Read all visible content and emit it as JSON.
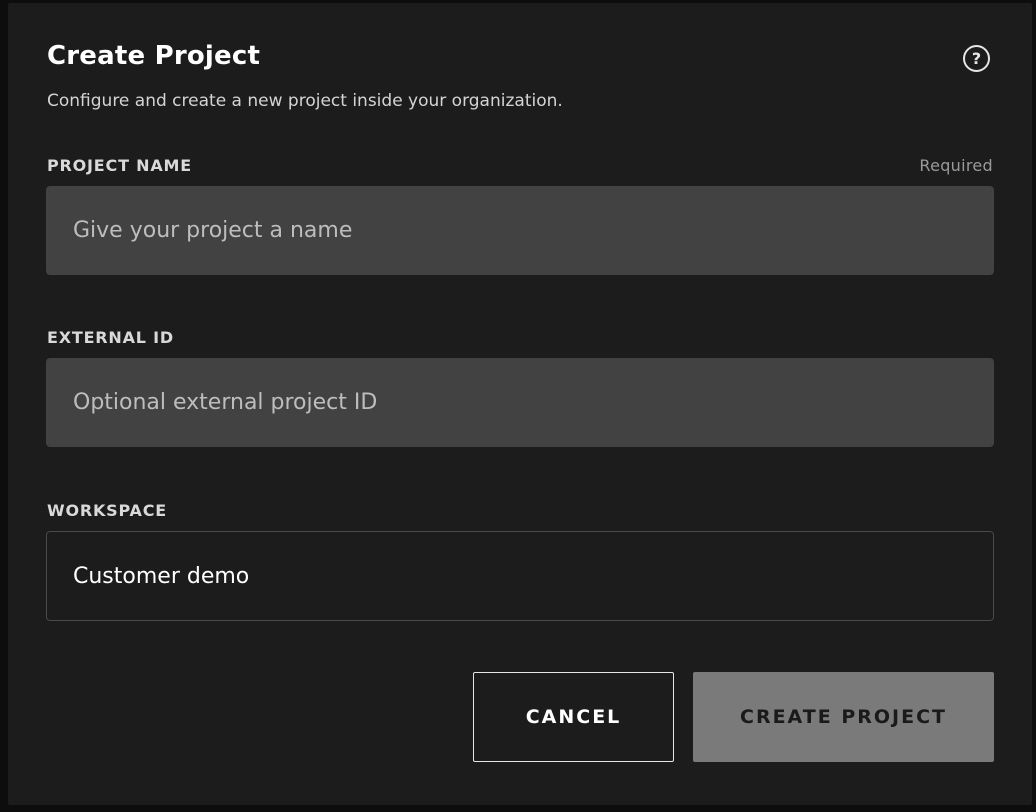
{
  "dialog": {
    "title": "Create Project",
    "subtitle": "Configure and create a new project inside your organization.",
    "help_icon": "question-circle-icon"
  },
  "fields": {
    "project_name": {
      "label": "PROJECT NAME",
      "required_text": "Required",
      "value": "",
      "placeholder": "Give your project a name"
    },
    "external_id": {
      "label": "EXTERNAL ID",
      "value": "",
      "placeholder": "Optional external project ID"
    },
    "workspace": {
      "label": "WORKSPACE",
      "selected": "Customer demo"
    }
  },
  "actions": {
    "cancel_label": "CANCEL",
    "create_label": "CREATE PROJECT"
  },
  "colors": {
    "dialog_bg": "#1c1c1c",
    "input_bg": "#424242",
    "create_button_bg": "#7a7a7a"
  }
}
